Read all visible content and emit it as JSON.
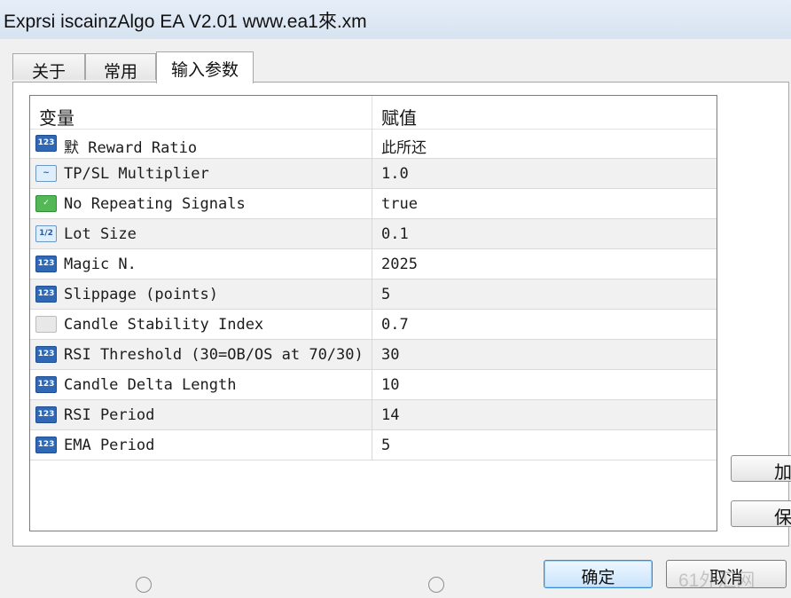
{
  "window": {
    "title": "Exprsi iscainzAlgo EA V2.01 www.ea1來.xm"
  },
  "tabs": [
    {
      "label": "关于",
      "active": false
    },
    {
      "label": "常用",
      "active": false
    },
    {
      "label": "输入参数",
      "active": true
    }
  ],
  "grid": {
    "columns": {
      "variable": "变量",
      "value": "赋值"
    },
    "rows": [
      {
        "icon": "int-icon",
        "icon_text": "123",
        "name": "默 Reward Ratio",
        "value": "此所还"
      },
      {
        "icon": "double-icon",
        "icon_text": "~",
        "name": "TP/SL Multiplier",
        "value": "1.0"
      },
      {
        "icon": "bool-icon",
        "icon_text": "✓",
        "name": "No Repeating Signals",
        "value": "true"
      },
      {
        "icon": "double-icon",
        "icon_text": "1/2",
        "name": "Lot Size",
        "value": "0.1"
      },
      {
        "icon": "int-icon",
        "icon_text": "123",
        "name": "Magic N.",
        "value": "2025"
      },
      {
        "icon": "int-icon",
        "icon_text": "123",
        "name": "Slippage (points)",
        "value": "5"
      },
      {
        "icon": "enum-icon",
        "icon_text": "",
        "name": "Candle Stability Index",
        "value": "0.7"
      },
      {
        "icon": "int-icon",
        "icon_text": "123",
        "name": "RSI Threshold (30=OB/OS at 70/30)",
        "value": "30"
      },
      {
        "icon": "int-icon",
        "icon_text": "123",
        "name": "Candle Delta Length",
        "value": "10"
      },
      {
        "icon": "int-icon",
        "icon_text": "123",
        "name": "RSI Period",
        "value": "14"
      },
      {
        "icon": "int-icon",
        "icon_text": "123",
        "name": "EMA Period",
        "value": "5"
      }
    ]
  },
  "side_buttons": {
    "load": "加",
    "save": "保"
  },
  "dialog_buttons": {
    "ok": "确定",
    "cancel": "取消"
  },
  "watermark": "61外汇网"
}
